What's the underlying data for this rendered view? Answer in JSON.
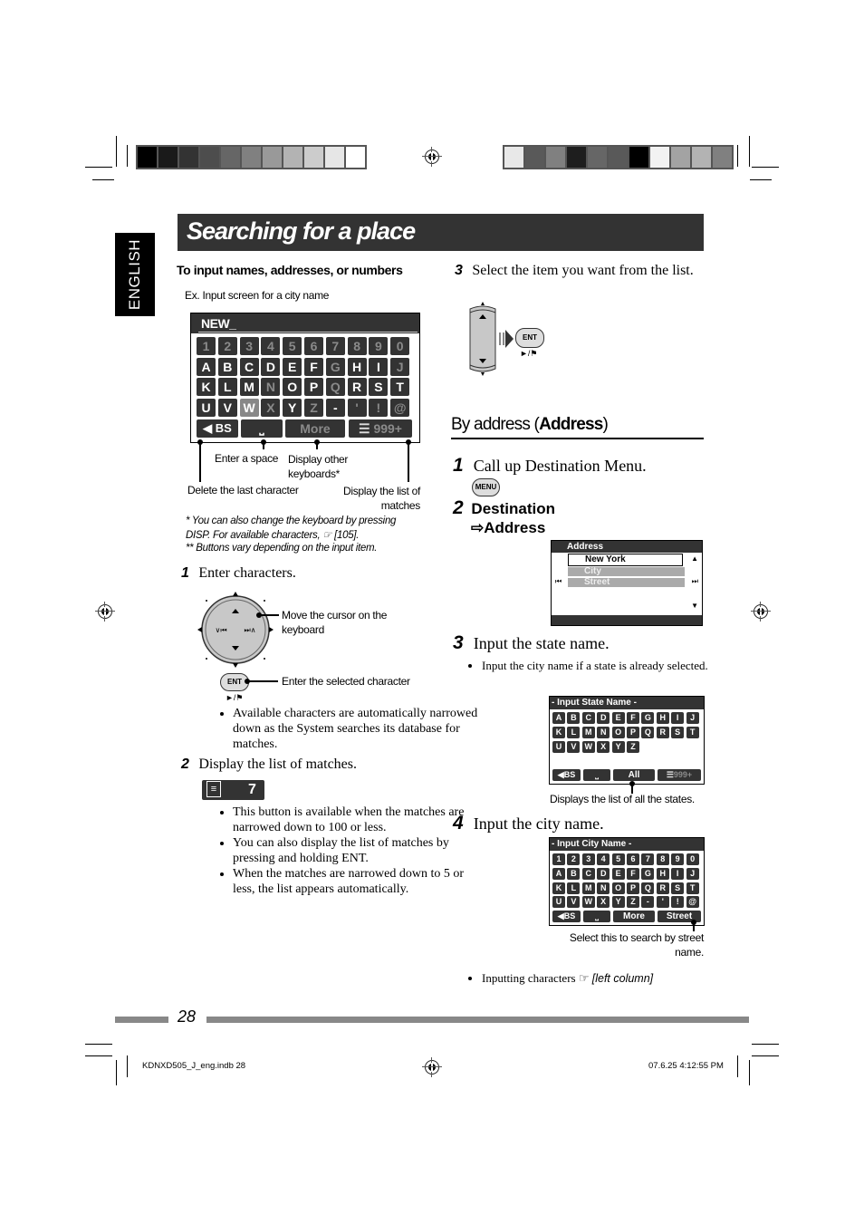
{
  "page": {
    "language_tab": "ENGLISH",
    "title": "Searching for a place",
    "page_number": "28",
    "footer_left": "KDNXD505_J_eng.indb   28",
    "footer_right": "07.6.25   4:12:55 PM",
    "color_bar_left": [
      "#000000",
      "#1a1a1a",
      "#333333",
      "#4d4d4d",
      "#666666",
      "#808080",
      "#999999",
      "#b3b3b3",
      "#cccccc",
      "#e6e6e6",
      "#ffffff"
    ],
    "color_bar_right": [
      "#e8e8e8",
      "#595959",
      "#808080",
      "#1e1e1e",
      "#666666",
      "#595959",
      "#000000",
      "#f2f2f2",
      "#a3a3a3",
      "#b3b3b3",
      "#808080"
    ]
  },
  "left": {
    "section_heading": "To input names, addresses, or numbers",
    "example_caption": "Ex. Input screen for a city name",
    "keyboard": {
      "input_value": "NEW_",
      "rows": [
        [
          {
            "k": "1",
            "dim": true
          },
          {
            "k": "2",
            "dim": true
          },
          {
            "k": "3",
            "dim": true
          },
          {
            "k": "4",
            "dim": true
          },
          {
            "k": "5",
            "dim": true
          },
          {
            "k": "6",
            "dim": true
          },
          {
            "k": "7",
            "dim": true
          },
          {
            "k": "8",
            "dim": true
          },
          {
            "k": "9",
            "dim": true
          },
          {
            "k": "0",
            "dim": true
          }
        ],
        [
          {
            "k": "A"
          },
          {
            "k": "B"
          },
          {
            "k": "C"
          },
          {
            "k": "D"
          },
          {
            "k": "E"
          },
          {
            "k": "F"
          },
          {
            "k": "G",
            "dim": true
          },
          {
            "k": "H"
          },
          {
            "k": "I"
          },
          {
            "k": "J",
            "dim": true
          }
        ],
        [
          {
            "k": "K"
          },
          {
            "k": "L"
          },
          {
            "k": "M"
          },
          {
            "k": "N",
            "dim": true
          },
          {
            "k": "O"
          },
          {
            "k": "P"
          },
          {
            "k": "Q",
            "dim": true
          },
          {
            "k": "R"
          },
          {
            "k": "S"
          },
          {
            "k": "T"
          }
        ],
        [
          {
            "k": "U"
          },
          {
            "k": "V"
          },
          {
            "k": "W",
            "sel": true
          },
          {
            "k": "X",
            "dim": true
          },
          {
            "k": "Y"
          },
          {
            "k": "Z",
            "dim": true
          },
          {
            "k": "-"
          },
          {
            "k": "'",
            "dim": true
          },
          {
            "k": "!",
            "dim": true
          },
          {
            "k": "@",
            "dim": true
          }
        ]
      ],
      "bottom": {
        "bs": "BS",
        "space": "⎵",
        "more": "More",
        "list": "999+"
      }
    },
    "callouts": {
      "space": "Enter a space",
      "other": "Display other keyboards*",
      "delete": "Delete the last character",
      "list": "Display the list of matches"
    },
    "footnotes": [
      "*   You can also change the keyboard by pressing DISP. For available characters, ☞ [105].",
      "** Buttons vary depending on the input item."
    ],
    "step1": {
      "num": "1",
      "label": "Enter characters."
    },
    "dial_callout": "Move the cursor on the keyboard",
    "ent_callout": "Enter the selected character",
    "ent_label": "ENT",
    "ent_sub": "►/⚑",
    "dial_left": "∨⏮",
    "dial_right": "⏭∧",
    "step1_bullets": [
      "Available characters are automatically narrowed down as the System searches its database for matches."
    ],
    "step2": {
      "num": "2",
      "label": "Display the list of matches."
    },
    "match_button_value": "7",
    "step2_bullets": [
      "This button is available when the matches are narrowed down to 100 or less.",
      "You can also display the list of matches by pressing and holding ENT.",
      "When the matches are narrowed down to 5 or less, the list appears automatically."
    ]
  },
  "right": {
    "step3_top": {
      "num": "3",
      "label": "Select the item you want from the list."
    },
    "ent_label": "ENT",
    "ent_sub": "►/⚑",
    "section_heading_pre": "By address (",
    "section_heading_bold": "Address",
    "section_heading_post": ")",
    "step1": {
      "num": "1",
      "label": "Call up Destination Menu."
    },
    "menu_button": "MENU",
    "step2": {
      "num": "2",
      "line1": "Destination",
      "line2": "⇨Address"
    },
    "address_screen": {
      "title": "Address",
      "items": [
        "New York",
        "City",
        "Street"
      ]
    },
    "step3": {
      "num": "3",
      "label": "Input the state name."
    },
    "step3_bullet": "Input the city name if a state is already selected.",
    "state_screen": {
      "title": "- Input State Name -",
      "rows": [
        [
          "A",
          "B",
          "C",
          "D",
          "E",
          "F",
          "G",
          "H",
          "I",
          "J"
        ],
        [
          "K",
          "L",
          "M",
          "N",
          "O",
          "P",
          "Q",
          "R",
          "S",
          "T"
        ],
        [
          "U",
          "V",
          "W",
          "X",
          "Y",
          "Z"
        ]
      ],
      "bottom": {
        "bs": "BS",
        "space": "⎵",
        "all": "All",
        "list": "999+"
      }
    },
    "state_callout": "Displays the list of all the states.",
    "step4": {
      "num": "4",
      "label": "Input the city name."
    },
    "city_screen": {
      "title": "- Input City Name -",
      "rows": [
        [
          "1",
          "2",
          "3",
          "4",
          "5",
          "6",
          "7",
          "8",
          "9",
          "0"
        ],
        [
          "A",
          "B",
          "C",
          "D",
          "E",
          "F",
          "G",
          "H",
          "I",
          "J"
        ],
        [
          "K",
          "L",
          "M",
          "N",
          "O",
          "P",
          "Q",
          "R",
          "S",
          "T"
        ],
        [
          "U",
          "V",
          "W",
          "X",
          "Y",
          "Z",
          "-",
          "'",
          "!",
          "@"
        ]
      ],
      "bottom": {
        "bs": "BS",
        "space": "⎵",
        "more": "More",
        "street": "Street"
      }
    },
    "city_callout": "Select this to search by street name.",
    "final_bullet_text": "Inputting characters ☞ ",
    "final_bullet_ref": "[left column]"
  }
}
